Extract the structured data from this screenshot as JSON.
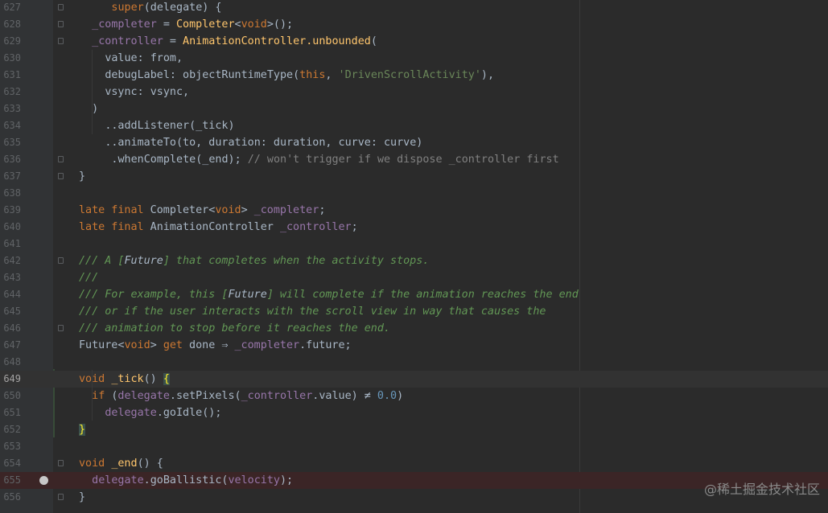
{
  "editor": {
    "lines": [
      {
        "n": "627",
        "t": "super(delegate) {"
      },
      {
        "n": "628",
        "t": "_completer = Completer<void>();"
      },
      {
        "n": "629",
        "t": "_controller = AnimationController.unbounded("
      },
      {
        "n": "630",
        "t": "value: from,"
      },
      {
        "n": "631",
        "t": "debugLabel: objectRuntimeType(this, 'DrivenScrollActivity'),"
      },
      {
        "n": "632",
        "t": "vsync: vsync,"
      },
      {
        "n": "633",
        "t": ")"
      },
      {
        "n": "634",
        "t": "..addListener(_tick)"
      },
      {
        "n": "635",
        "t": "..animateTo(to, duration: duration, curve: curve)"
      },
      {
        "n": "636",
        "t": ".whenComplete(_end); // won't trigger if we dispose _controller first"
      },
      {
        "n": "637",
        "t": "}"
      },
      {
        "n": "638",
        "t": ""
      },
      {
        "n": "639",
        "t": "late final Completer<void> _completer;"
      },
      {
        "n": "640",
        "t": "late final AnimationController _controller;"
      },
      {
        "n": "641",
        "t": ""
      },
      {
        "n": "642",
        "t": "/// A [Future] that completes when the activity stops."
      },
      {
        "n": "643",
        "t": "///"
      },
      {
        "n": "644",
        "t": "/// For example, this [Future] will complete if the animation reaches the end"
      },
      {
        "n": "645",
        "t": "/// or if the user interacts with the scroll view in way that causes the"
      },
      {
        "n": "646",
        "t": "/// animation to stop before it reaches the end."
      },
      {
        "n": "647",
        "t": "Future<void> get done ⇒ _completer.future;"
      },
      {
        "n": "648",
        "t": ""
      },
      {
        "n": "649",
        "t": "void _tick() {"
      },
      {
        "n": "650",
        "t": "if (delegate.setPixels(_controller.value) ≠ 0.0)"
      },
      {
        "n": "651",
        "t": "delegate.goIdle();"
      },
      {
        "n": "652",
        "t": "}"
      },
      {
        "n": "653",
        "t": ""
      },
      {
        "n": "654",
        "t": "void _end() {"
      },
      {
        "n": "655",
        "t": "delegate.goBallistic(velocity);"
      },
      {
        "n": "656",
        "t": "}"
      }
    ],
    "current_line": "649",
    "breakpoint_line": "655",
    "colors": {
      "background": "#2b2b2b",
      "keyword": "#cc7832",
      "function": "#ffc66d",
      "field": "#9876aa",
      "string": "#6a8759",
      "number": "#6897bb",
      "doc_comment": "#629755"
    }
  },
  "watermark": "@稀土掘金技术社区"
}
